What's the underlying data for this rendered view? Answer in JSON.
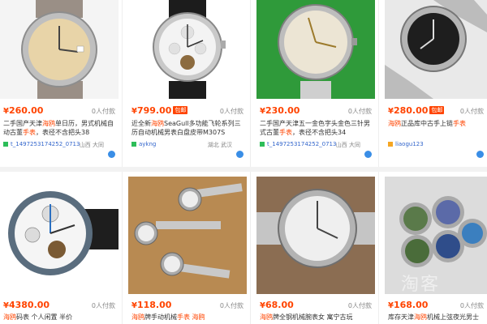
{
  "listings": [
    {
      "price": "260.00",
      "paid": "0人付款",
      "title_prefix": "二手国产天津",
      "title_hl": "海鸥",
      "title_rest": "单日历，男式机械自动古董",
      "title_hl2": "手表",
      "title_rest2": "，表径不含把头38",
      "seller": "t_1497253174252_0713",
      "location": "山西 大同"
    },
    {
      "price": "799.00",
      "badge": "包邮",
      "paid": "0人付款",
      "title_prefix": "近全新",
      "title_hl": "海鸥",
      "title_rest": "SeaGull多功能飞轮系列三历自动机械男表白盘皮带M307S",
      "seller": "aykng",
      "location": "湖北 武汉"
    },
    {
      "price": "230.00",
      "paid": "0人付款",
      "title_prefix": "二手国产天津五一金色字头金色三针男式古董",
      "title_hl": "手表",
      "title_rest": "，表径不含把头34",
      "seller": "t_1497253174252_0713",
      "location": "山西 大同"
    },
    {
      "price": "280.00",
      "badge": "包邮",
      "paid": "0人付款",
      "title_hl": "海鸥",
      "title_rest": "正品库中古手上链",
      "title_hl2": "手表",
      "title_rest2": "",
      "seller": "liaogu123",
      "location": ""
    },
    {
      "price": "4380.00",
      "paid": "0人付款",
      "title_hl": "海鸥",
      "title_rest": "码表 个人闲置 半价",
      "seller": "",
      "location": ""
    },
    {
      "price": "118.00",
      "paid": "0人付款",
      "title_hl": "海鸥",
      "title_rest": "牌手动机械",
      "title_hl2": "手表 海鸥",
      "title_rest2": "",
      "seller": "",
      "location": ""
    },
    {
      "price": "68.00",
      "paid": "0人付款",
      "title_hl": "海鸥",
      "title_rest": "牌全钢机械腕表女 寓宁古玩",
      "seller": "",
      "location": ""
    },
    {
      "price": "168.00",
      "paid": "0人付款",
      "title_prefix": "库存天津",
      "title_hl": "海鸥",
      "title_rest": "机械上弦夜光男士",
      "seller": "",
      "location": ""
    }
  ],
  "currency": "¥",
  "watermark": "淘客",
  "colors": {
    "price": "#ff4400",
    "seller": "#3366cc",
    "dot": "#3a8ee6"
  }
}
